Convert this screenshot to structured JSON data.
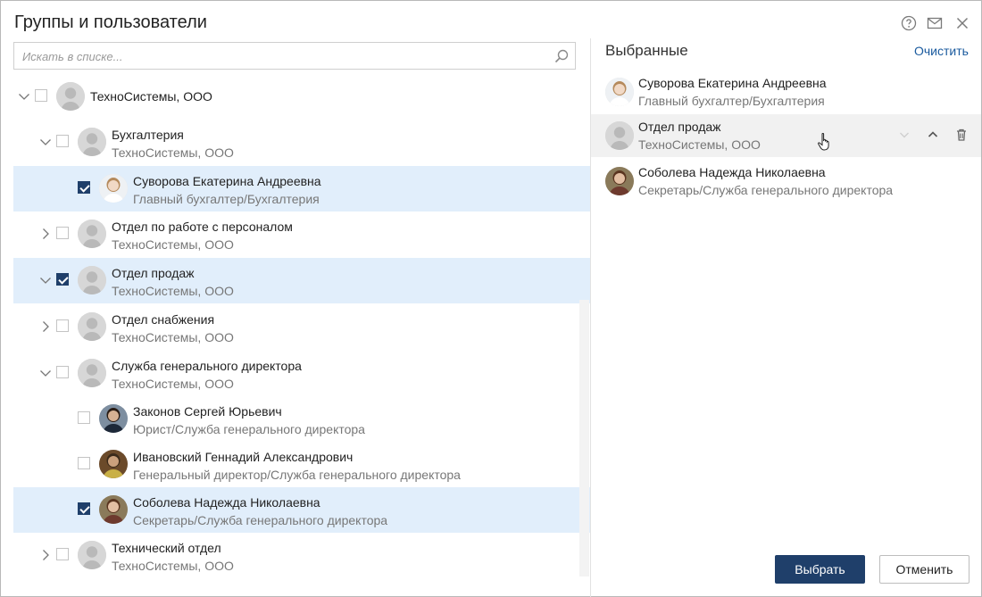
{
  "header": {
    "title": "Группы и пользователи",
    "icons": [
      "help-icon",
      "mail-icon",
      "close-icon"
    ]
  },
  "search": {
    "placeholder": "Искать в списке...",
    "value": ""
  },
  "tree": [
    {
      "name": "ТехноСистемы, ООО",
      "sub": "",
      "expand": "expanded",
      "checked": false,
      "avatar": "group",
      "level": 0
    },
    {
      "name": "Бухгалтерия",
      "sub": "ТехноСистемы, ООО",
      "expand": "expanded",
      "checked": false,
      "avatar": "group",
      "level": 1
    },
    {
      "name": "Суворова Екатерина Андреевна",
      "sub": "Главный бухгалтер/Бухгалтерия",
      "expand": "none",
      "checked": true,
      "avatar": "photo-suvorova",
      "level": 2
    },
    {
      "name": "Отдел по работе с персоналом",
      "sub": "ТехноСистемы, ООО",
      "expand": "collapsed",
      "checked": false,
      "avatar": "group",
      "level": 1
    },
    {
      "name": "Отдел продаж",
      "sub": "ТехноСистемы, ООО",
      "expand": "expanded",
      "checked": true,
      "avatar": "group",
      "level": 1
    },
    {
      "name": "Отдел снабжения",
      "sub": "ТехноСистемы, ООО",
      "expand": "collapsed",
      "checked": false,
      "avatar": "group",
      "level": 1
    },
    {
      "name": "Служба генерального директора",
      "sub": "ТехноСистемы, ООО",
      "expand": "expanded",
      "checked": false,
      "avatar": "group",
      "level": 1
    },
    {
      "name": "Законов Сергей Юрьевич",
      "sub": "Юрист/Служба генерального директора",
      "expand": "none",
      "checked": false,
      "avatar": "photo-zakonov",
      "level": 2
    },
    {
      "name": "Ивановский Геннадий Александрович",
      "sub": "Генеральный директор/Служба генерального директора",
      "expand": "none",
      "checked": false,
      "avatar": "photo-ivanovsky",
      "level": 2
    },
    {
      "name": "Соболева Надежда Николаевна",
      "sub": "Секретарь/Служба генерального директора",
      "expand": "none",
      "checked": true,
      "avatar": "photo-soboleva",
      "level": 2
    },
    {
      "name": "Технический отдел",
      "sub": "ТехноСистемы, ООО",
      "expand": "collapsed",
      "checked": false,
      "avatar": "group",
      "level": 1
    }
  ],
  "selected_panel": {
    "title": "Выбранные",
    "clear_label": "Очистить",
    "items": [
      {
        "name": "Суворова Екатерина Андреевна",
        "sub": "Главный бухгалтер/Бухгалтерия",
        "avatar": "photo-suvorova"
      },
      {
        "name": "Отдел продаж",
        "sub": "ТехноСистемы, ООО",
        "avatar": "group",
        "actions": [
          "move-down-icon",
          "move-up-icon",
          "trash-icon"
        ]
      },
      {
        "name": "Соболева Надежда Николаевна",
        "sub": "Секретарь/Служба генерального директора",
        "avatar": "photo-soboleva"
      }
    ]
  },
  "buttons": {
    "select_label": "Выбрать",
    "cancel_label": "Отменить"
  },
  "colors": {
    "primary": "#1f3f6a",
    "link": "#1a5a9e",
    "selected_row": "#e1eefb",
    "hover_row": "#f1f1f1"
  }
}
